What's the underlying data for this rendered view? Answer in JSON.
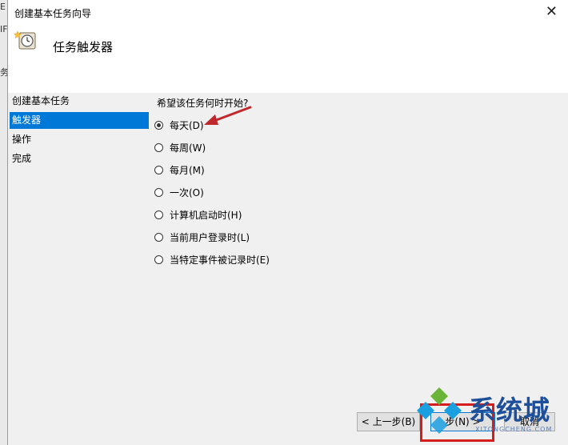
{
  "background": {
    "fragments": [
      "E",
      "IF",
      "务"
    ]
  },
  "dialog": {
    "title": "创建基本任务向导",
    "close_glyph": "✕",
    "header_title": "任务触发器"
  },
  "nav": {
    "items": [
      {
        "label": "创建基本任务",
        "selected": false
      },
      {
        "label": "触发器",
        "selected": true
      },
      {
        "label": "操作",
        "selected": false
      },
      {
        "label": "完成",
        "selected": false
      }
    ]
  },
  "form": {
    "question": "希望该任务何时开始?",
    "options": [
      {
        "label": "每天(D)",
        "checked": true
      },
      {
        "label": "每周(W)",
        "checked": false
      },
      {
        "label": "每月(M)",
        "checked": false
      },
      {
        "label": "一次(O)",
        "checked": false
      },
      {
        "label": "计算机启动时(H)",
        "checked": false
      },
      {
        "label": "当前用户登录时(L)",
        "checked": false
      },
      {
        "label": "当特定事件被记录时(E)",
        "checked": false
      }
    ]
  },
  "buttons": {
    "back": "< 上一步(B)",
    "next": "步(N) >",
    "cancel": "取消"
  },
  "watermark": {
    "text": "系统城",
    "sub": "XITONGCHENG.COM"
  },
  "colors": {
    "selection": "#0078d7",
    "arrow": "#c0282b",
    "highlight_box": "#d51d1d",
    "watermark_blue": "#1e4f9a",
    "watermark_green": "#6ab437",
    "watermark_cyan": "#1aa0e0"
  }
}
